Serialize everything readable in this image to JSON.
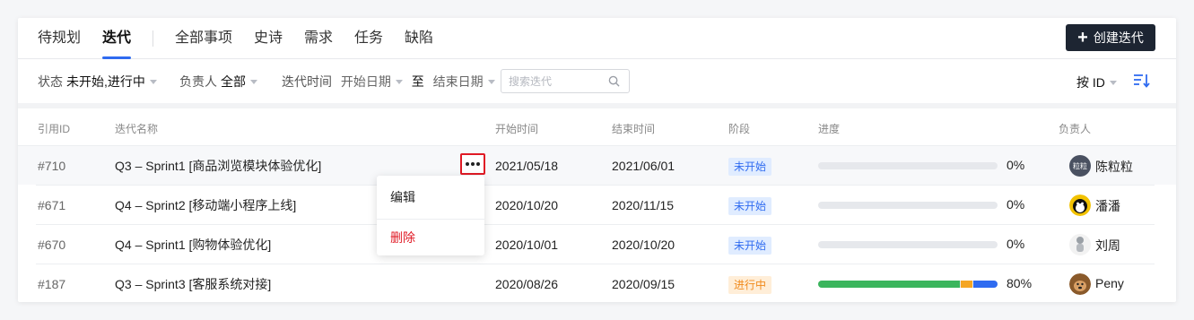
{
  "tabs": [
    {
      "label": "待规划"
    },
    {
      "label": "迭代"
    },
    {
      "label": "全部事项"
    },
    {
      "label": "史诗"
    },
    {
      "label": "需求"
    },
    {
      "label": "任务"
    },
    {
      "label": "缺陷"
    }
  ],
  "active_tab": "迭代",
  "create_button": {
    "icon": "plus-icon",
    "label": "创建迭代"
  },
  "filters": {
    "status_label": "状态",
    "status_value": "未开始,进行中",
    "owner_label": "负责人",
    "owner_value": "全部",
    "time_label": "迭代时间",
    "start_placeholder": "开始日期",
    "to_label": "至",
    "end_placeholder": "结束日期",
    "search_placeholder": "搜索迭代",
    "sort_label": "按 ID"
  },
  "table": {
    "headers": {
      "id": "引用ID",
      "name": "迭代名称",
      "start": "开始时间",
      "end": "结束时间",
      "stage": "阶段",
      "progress": "进度",
      "owner": "负责人"
    },
    "rows": [
      {
        "id": "#710",
        "name": "Q3 – Sprint1 [商品浏览模块体验优化]",
        "start": "2021/05/18",
        "end": "2021/06/01",
        "stage": "未开始",
        "stage_type": "notstart",
        "progress_text": "0%",
        "progress": {
          "green": 0,
          "orange": 0,
          "blue": 0
        },
        "owner": "陈粒粒",
        "avatar_text": "粒粒",
        "avatar_color": "#4a5161"
      },
      {
        "id": "#671",
        "name": "Q4 – Sprint2 [移动端小程序上线]",
        "start": "2020/10/20",
        "end": "2020/11/15",
        "stage": "未开始",
        "stage_type": "notstart",
        "progress_text": "0%",
        "progress": {
          "green": 0,
          "orange": 0,
          "blue": 0
        },
        "owner": "潘潘",
        "avatar_text": "",
        "avatar_color": "#f2c200"
      },
      {
        "id": "#670",
        "name": "Q4 – Sprint1 [购物体验优化]",
        "start": "2020/10/01",
        "end": "2020/10/20",
        "stage": "未开始",
        "stage_type": "notstart",
        "progress_text": "0%",
        "progress": {
          "green": 0,
          "orange": 0,
          "blue": 0
        },
        "owner": "刘周",
        "avatar_text": "",
        "avatar_color": "#e4e4e4"
      },
      {
        "id": "#187",
        "name": "Q3 – Sprint3 [客服系统对接]",
        "start": "2020/08/26",
        "end": "2020/09/15",
        "stage": "进行中",
        "stage_type": "doing",
        "progress_text": "80%",
        "progress": {
          "green": 0.8,
          "orange": 0.065,
          "blue": 0.135
        },
        "owner": "Peny",
        "avatar_text": "",
        "avatar_color": "#8a5a2b"
      }
    ]
  },
  "row_menu": {
    "edit": "编辑",
    "delete": "删除"
  },
  "colors": {
    "accent": "#2f6bf0",
    "danger": "#e01a25",
    "progress_green": "#3bb55d",
    "progress_orange": "#f5a623",
    "progress_blue": "#2f6bf0"
  }
}
